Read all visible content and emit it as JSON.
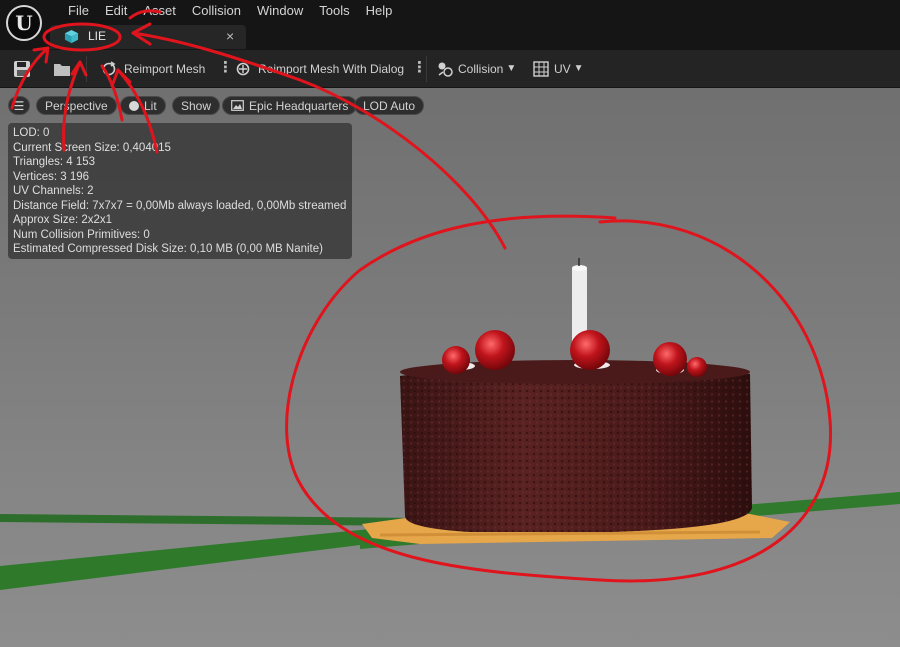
{
  "menu": [
    "File",
    "Edit",
    "Asset",
    "Collision",
    "Window",
    "Tools",
    "Help"
  ],
  "tab": {
    "label": "LIE",
    "close": "×"
  },
  "toolbar": {
    "reimport": "Reimport Mesh",
    "reimport_dialog": "Reimport Mesh With Dialog",
    "collision": "Collision",
    "uv": "UV"
  },
  "viewport": {
    "perspective": "Perspective",
    "lit": "Lit",
    "show": "Show",
    "scene": "Epic Headquarters",
    "lod": "LOD Auto"
  },
  "stats": [
    "LOD:  0",
    "Current Screen Size:  0,404015",
    "Triangles:  4 153",
    "Vertices:  3 196",
    "UV Channels:  2",
    "Distance Field:  7x7x7 = 0,00Mb always loaded, 0,00Mb streamed",
    "Approx Size:  2x2x1",
    "Num Collision Primitives:  0",
    "Estimated Compressed Disk Size: 0,10 MB (0,00 MB Nanite)"
  ],
  "icons": {
    "logo": "unreal-logo-icon",
    "tab": "static-mesh-icon",
    "save": "save-icon",
    "browse": "folder-icon",
    "reimport": "reimport-icon",
    "collision": "collision-icon",
    "uv": "uv-grid-icon"
  },
  "colors": {
    "annotation": "#e0141c",
    "floor_line": "#2e7a2a",
    "cherry": "#c0141c"
  }
}
